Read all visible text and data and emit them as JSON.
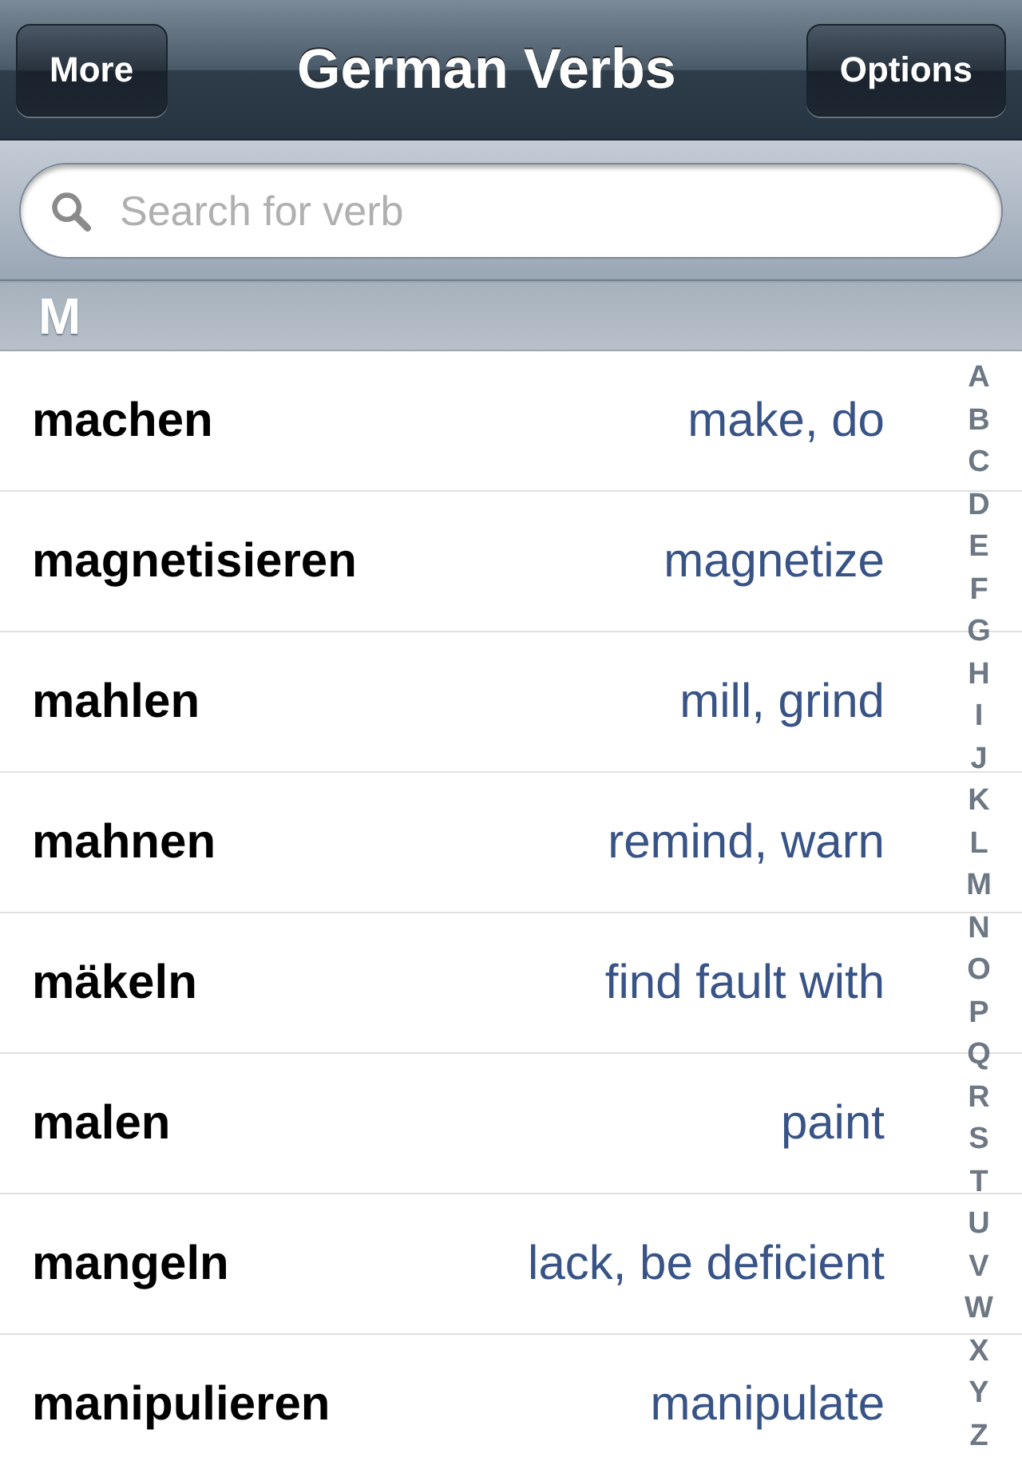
{
  "nav_bar": {
    "title": "German Verbs",
    "left_button": "More",
    "right_button": "Options"
  },
  "search": {
    "placeholder": "Search for verb"
  },
  "section": {
    "header": "M"
  },
  "rows": [
    {
      "verb": "machen",
      "translation": "make, do"
    },
    {
      "verb": "magnetisieren",
      "translation": "magnetize"
    },
    {
      "verb": "mahlen",
      "translation": "mill, grind"
    },
    {
      "verb": "mahnen",
      "translation": "remind, warn"
    },
    {
      "verb": "mäkeln",
      "translation": "find fault with"
    },
    {
      "verb": "malen",
      "translation": "paint"
    },
    {
      "verb": "mangeln",
      "translation": "lack, be deficient"
    },
    {
      "verb": "manipulieren",
      "translation": "manipulate"
    }
  ],
  "index": [
    "A",
    "B",
    "C",
    "D",
    "E",
    "F",
    "G",
    "H",
    "I",
    "J",
    "K",
    "L",
    "M",
    "N",
    "O",
    "P",
    "Q",
    "R",
    "S",
    "T",
    "U",
    "V",
    "W",
    "X",
    "Y",
    "Z"
  ]
}
